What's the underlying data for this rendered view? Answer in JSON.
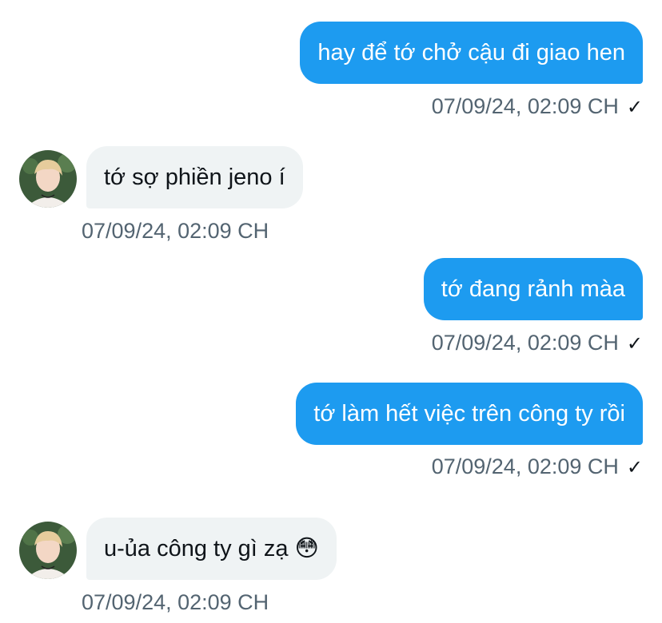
{
  "messages": [
    {
      "direction": "out",
      "text": "hay để tớ chở cậu đi giao hen",
      "time": "07/09/24, 02:09 CH",
      "status_icon": "✓"
    },
    {
      "direction": "in",
      "text": "tớ sợ phiền jeno í",
      "time": "07/09/24, 02:09 CH"
    },
    {
      "direction": "out",
      "text": "tớ đang rảnh màa",
      "time": "07/09/24, 02:09 CH",
      "status_icon": "✓"
    },
    {
      "direction": "out",
      "text": "tớ làm hết việc trên công ty rồi",
      "time": "07/09/24, 02:09 CH",
      "status_icon": "✓"
    },
    {
      "direction": "in",
      "text": "u-ủa công ty gì zạ 😳",
      "time": "07/09/24, 02:09 CH"
    }
  ],
  "icons": {
    "avatar": "avatar-icon",
    "seen": "checkmark-icon"
  },
  "colors": {
    "outgoing_bubble": "#1d9bf0",
    "incoming_bubble": "#eff3f4",
    "timestamp": "#536471"
  }
}
